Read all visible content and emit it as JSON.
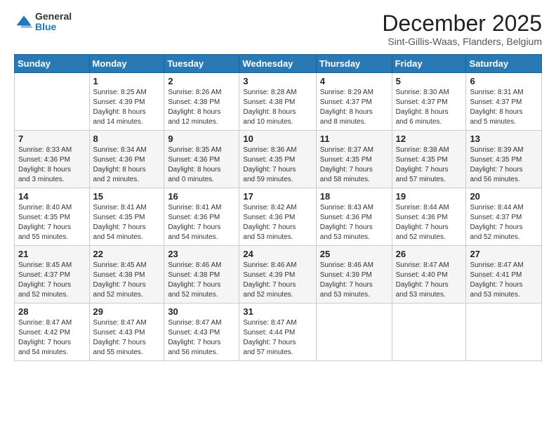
{
  "header": {
    "logo_general": "General",
    "logo_blue": "Blue",
    "month_title": "December 2025",
    "location": "Sint-Gillis-Waas, Flanders, Belgium"
  },
  "weekdays": [
    "Sunday",
    "Monday",
    "Tuesday",
    "Wednesday",
    "Thursday",
    "Friday",
    "Saturday"
  ],
  "weeks": [
    [
      {
        "day": "",
        "info": ""
      },
      {
        "day": "1",
        "info": "Sunrise: 8:25 AM\nSunset: 4:39 PM\nDaylight: 8 hours\nand 14 minutes."
      },
      {
        "day": "2",
        "info": "Sunrise: 8:26 AM\nSunset: 4:38 PM\nDaylight: 8 hours\nand 12 minutes."
      },
      {
        "day": "3",
        "info": "Sunrise: 8:28 AM\nSunset: 4:38 PM\nDaylight: 8 hours\nand 10 minutes."
      },
      {
        "day": "4",
        "info": "Sunrise: 8:29 AM\nSunset: 4:37 PM\nDaylight: 8 hours\nand 8 minutes."
      },
      {
        "day": "5",
        "info": "Sunrise: 8:30 AM\nSunset: 4:37 PM\nDaylight: 8 hours\nand 6 minutes."
      },
      {
        "day": "6",
        "info": "Sunrise: 8:31 AM\nSunset: 4:37 PM\nDaylight: 8 hours\nand 5 minutes."
      }
    ],
    [
      {
        "day": "7",
        "info": "Sunrise: 8:33 AM\nSunset: 4:36 PM\nDaylight: 8 hours\nand 3 minutes."
      },
      {
        "day": "8",
        "info": "Sunrise: 8:34 AM\nSunset: 4:36 PM\nDaylight: 8 hours\nand 2 minutes."
      },
      {
        "day": "9",
        "info": "Sunrise: 8:35 AM\nSunset: 4:36 PM\nDaylight: 8 hours\nand 0 minutes."
      },
      {
        "day": "10",
        "info": "Sunrise: 8:36 AM\nSunset: 4:35 PM\nDaylight: 7 hours\nand 59 minutes."
      },
      {
        "day": "11",
        "info": "Sunrise: 8:37 AM\nSunset: 4:35 PM\nDaylight: 7 hours\nand 58 minutes."
      },
      {
        "day": "12",
        "info": "Sunrise: 8:38 AM\nSunset: 4:35 PM\nDaylight: 7 hours\nand 57 minutes."
      },
      {
        "day": "13",
        "info": "Sunrise: 8:39 AM\nSunset: 4:35 PM\nDaylight: 7 hours\nand 56 minutes."
      }
    ],
    [
      {
        "day": "14",
        "info": "Sunrise: 8:40 AM\nSunset: 4:35 PM\nDaylight: 7 hours\nand 55 minutes."
      },
      {
        "day": "15",
        "info": "Sunrise: 8:41 AM\nSunset: 4:35 PM\nDaylight: 7 hours\nand 54 minutes."
      },
      {
        "day": "16",
        "info": "Sunrise: 8:41 AM\nSunset: 4:36 PM\nDaylight: 7 hours\nand 54 minutes."
      },
      {
        "day": "17",
        "info": "Sunrise: 8:42 AM\nSunset: 4:36 PM\nDaylight: 7 hours\nand 53 minutes."
      },
      {
        "day": "18",
        "info": "Sunrise: 8:43 AM\nSunset: 4:36 PM\nDaylight: 7 hours\nand 53 minutes."
      },
      {
        "day": "19",
        "info": "Sunrise: 8:44 AM\nSunset: 4:36 PM\nDaylight: 7 hours\nand 52 minutes."
      },
      {
        "day": "20",
        "info": "Sunrise: 8:44 AM\nSunset: 4:37 PM\nDaylight: 7 hours\nand 52 minutes."
      }
    ],
    [
      {
        "day": "21",
        "info": "Sunrise: 8:45 AM\nSunset: 4:37 PM\nDaylight: 7 hours\nand 52 minutes."
      },
      {
        "day": "22",
        "info": "Sunrise: 8:45 AM\nSunset: 4:38 PM\nDaylight: 7 hours\nand 52 minutes."
      },
      {
        "day": "23",
        "info": "Sunrise: 8:46 AM\nSunset: 4:38 PM\nDaylight: 7 hours\nand 52 minutes."
      },
      {
        "day": "24",
        "info": "Sunrise: 8:46 AM\nSunset: 4:39 PM\nDaylight: 7 hours\nand 52 minutes."
      },
      {
        "day": "25",
        "info": "Sunrise: 8:46 AM\nSunset: 4:39 PM\nDaylight: 7 hours\nand 53 minutes."
      },
      {
        "day": "26",
        "info": "Sunrise: 8:47 AM\nSunset: 4:40 PM\nDaylight: 7 hours\nand 53 minutes."
      },
      {
        "day": "27",
        "info": "Sunrise: 8:47 AM\nSunset: 4:41 PM\nDaylight: 7 hours\nand 53 minutes."
      }
    ],
    [
      {
        "day": "28",
        "info": "Sunrise: 8:47 AM\nSunset: 4:42 PM\nDaylight: 7 hours\nand 54 minutes."
      },
      {
        "day": "29",
        "info": "Sunrise: 8:47 AM\nSunset: 4:43 PM\nDaylight: 7 hours\nand 55 minutes."
      },
      {
        "day": "30",
        "info": "Sunrise: 8:47 AM\nSunset: 4:43 PM\nDaylight: 7 hours\nand 56 minutes."
      },
      {
        "day": "31",
        "info": "Sunrise: 8:47 AM\nSunset: 4:44 PM\nDaylight: 7 hours\nand 57 minutes."
      },
      {
        "day": "",
        "info": ""
      },
      {
        "day": "",
        "info": ""
      },
      {
        "day": "",
        "info": ""
      }
    ]
  ]
}
